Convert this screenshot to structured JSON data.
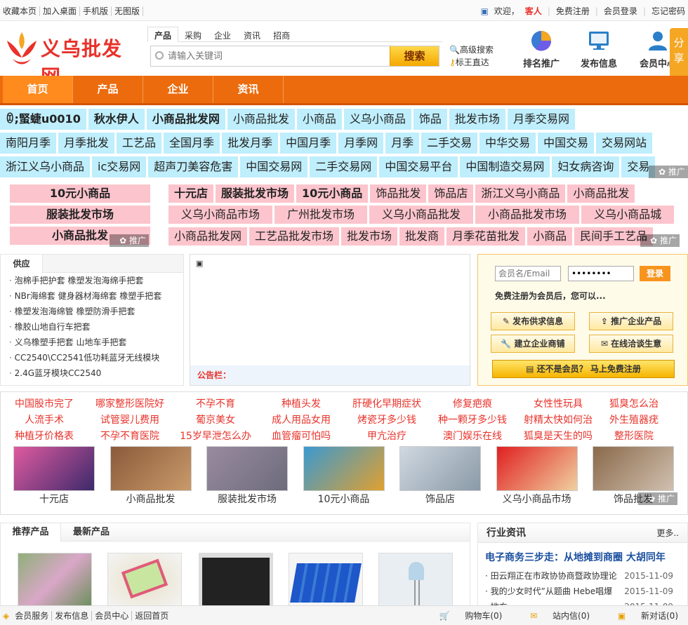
{
  "topbar": {
    "left": [
      "收藏本页",
      "加入桌面",
      "手机版",
      "无图版"
    ],
    "welcome": "欢迎，",
    "guest": "客人",
    "links": [
      "免费注册",
      "会员登录",
      "忘记密码"
    ]
  },
  "logo": {
    "text": "义乌批发网"
  },
  "search": {
    "tabs": [
      "产品",
      "采购",
      "企业",
      "资讯",
      "招商"
    ],
    "placeholder": "请输入关键词",
    "button": "搜索",
    "adv": "高级搜索",
    "zhida": "标王直达"
  },
  "header_icons": [
    "排名推广",
    "发布信息",
    "会员中心"
  ],
  "share": "分享",
  "nav": [
    "首页",
    "产品",
    "企业",
    "资讯"
  ],
  "kw_row1": [
    "ꀧ;蜸蜨u0010",
    "秋水伊人",
    "小商品批发网",
    "小商品批发",
    "小商品",
    "义乌小商品",
    "饰品",
    "批发市场",
    "月季交易网"
  ],
  "kw_row2": [
    "南阳月季",
    "月季批发",
    "工艺品",
    "全国月季",
    "批发月季",
    "中国月季",
    "月季网",
    "月季",
    "二手交易",
    "中华交易",
    "中国交易",
    "交易网站"
  ],
  "kw_row3": [
    "浙江义乌小商品",
    "ic交易网",
    "超声刀美容危害",
    "中国交易网",
    "二手交易网",
    "中国交易平台",
    "中国制造交易网",
    "妇女病咨询",
    "交易"
  ],
  "pk_left": [
    "10元小商品",
    "服装批发市场",
    "小商品批发"
  ],
  "pk_row1": [
    "十元店",
    "服装批发市场",
    "10元小商品",
    "饰品批发",
    "饰品店",
    "浙江义乌小商品",
    "小商品批发"
  ],
  "pk_row2": [
    "义乌小商品市场",
    "广州批发市场",
    "义乌小商品批发",
    "小商品批发市场",
    "义乌小商品城"
  ],
  "pk_row3": [
    "小商品批发网",
    "工艺品批发市场",
    "批发市场",
    "批发商",
    "月季花苗批发",
    "小商品",
    "民间手工艺品"
  ],
  "tuiguang": "推广",
  "supply": {
    "title": "供应",
    "items": [
      "泡棉手把护套  橡塑发泡海绵手把套",
      "NBr海绵套  健身器材海绵套  橡塑手把套",
      "橡塑发泡海绵管  橡塑防滑手把套",
      "橡胶山地自行车把套",
      "义乌橡塑手把套  山地车手把套",
      "CC2540\\CC2541低功耗蓝牙无线模块",
      "2.4G蓝牙模块CC2540"
    ]
  },
  "announce": "公告栏：",
  "login": {
    "user_ph": "会员名/Email",
    "pwd": "••••••••",
    "btn": "登录",
    "hint": "免费注册为会员后，您可以...",
    "b1": "发布供求信息",
    "b2": "推广企业产品",
    "b3": "建立企业商铺",
    "b4": "在线洽谈生意",
    "reg": "还不是会员？ 马上免费注册"
  },
  "ads": [
    [
      "中国股市完了",
      "哪家整形医院好",
      "不孕不育",
      "种植头发",
      "肝硬化早期症状",
      "修复疤痕",
      "女性性玩具",
      "狐臭怎么治"
    ],
    [
      "人流手术",
      "试管婴儿费用",
      "葡京美女",
      "成人用品女用",
      "烤瓷牙多少钱",
      "种一颗牙多少钱",
      "射精太快如何治",
      "外生殖器疣"
    ],
    [
      "种植牙价格表",
      "不孕不育医院",
      "15岁早泄怎么办",
      "血管瘤可怕吗",
      "甲亢治疗",
      "澳门娱乐在线",
      "狐臭是天生的吗",
      "整形医院"
    ]
  ],
  "pics": [
    "十元店",
    "小商品批发",
    "服装批发市场",
    "10元小商品",
    "饰品店",
    "义乌小商品市场",
    "饰品批发"
  ],
  "rec": {
    "tabs": [
      "推荐产品",
      "最新产品"
    ]
  },
  "news": {
    "title": "行业资讯",
    "more": "更多..",
    "headline": "电子商务三步走：从地摊到商圈  大胡同年",
    "items": [
      [
        "田云翔正在市政协协商暨政协理论",
        "2015-11-09"
      ],
      [
        "我的少女时代”从题曲 Hebe唱爆",
        "2015-11-09"
      ],
      [
        "地方",
        "2015-11-09"
      ]
    ]
  },
  "bottombar": {
    "left": [
      "会员服务",
      "发布信息",
      "会员中心",
      "返回首页"
    ],
    "cart": "购物车(0)",
    "msg": "站内信(0)",
    "chat": "新对话(0)"
  }
}
